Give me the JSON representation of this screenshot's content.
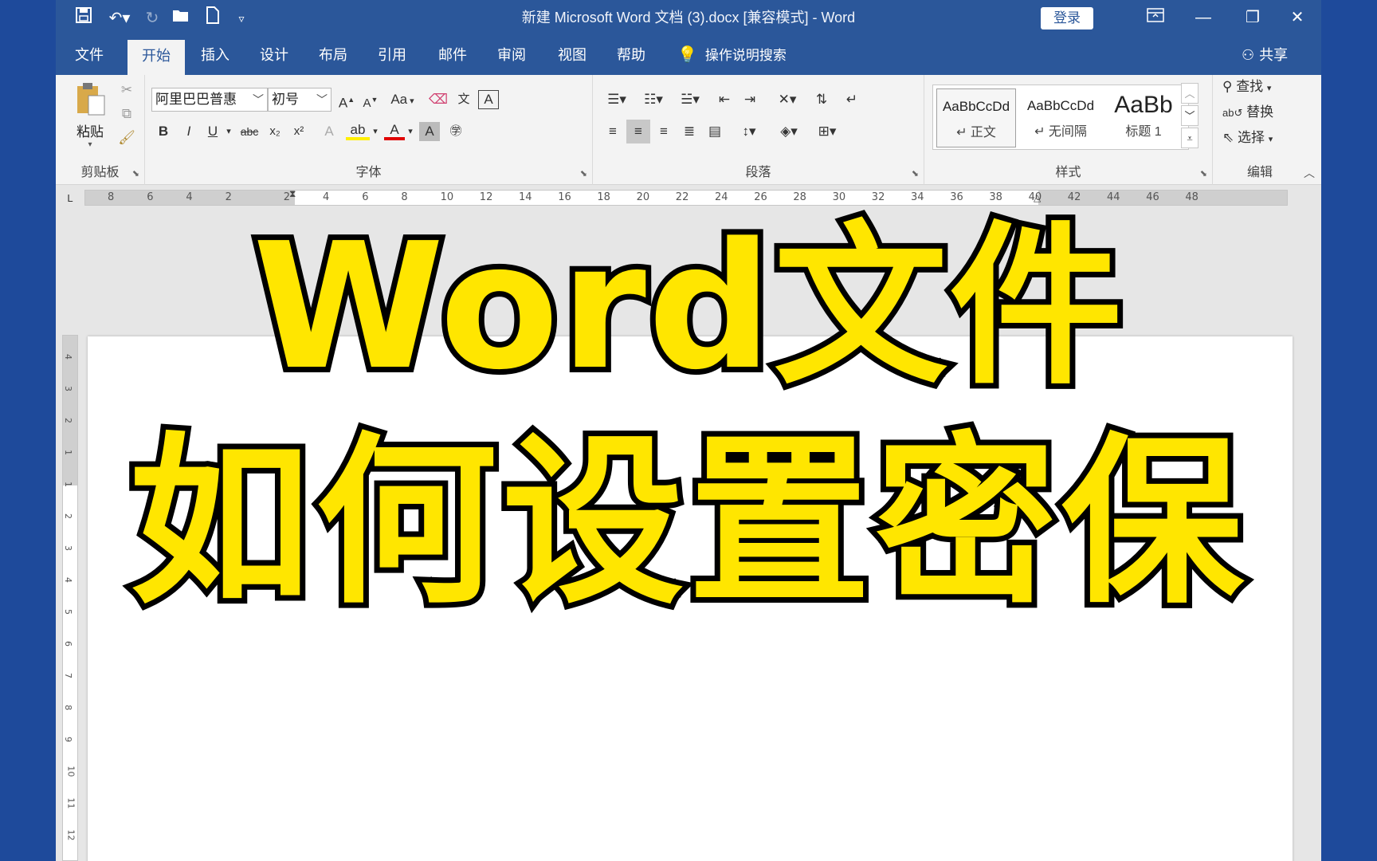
{
  "titlebar": {
    "document_title": "新建 Microsoft Word 文档 (3).docx [兼容模式]  -  Word",
    "login_label": "登录",
    "quick_access": {
      "save_icon": "save-icon",
      "undo_icon": "undo-icon",
      "redo_icon": "redo-icon",
      "open_icon": "open-folder-icon",
      "new_icon": "new-document-icon",
      "customize_icon": "customize-toolbar-icon"
    }
  },
  "tabs": [
    "文件",
    "开始",
    "插入",
    "设计",
    "布局",
    "引用",
    "邮件",
    "审阅",
    "视图",
    "帮助"
  ],
  "active_tab": "开始",
  "tell_me": "操作说明搜索",
  "share_label": "共享",
  "ribbon": {
    "clipboard": {
      "paste_label": "粘贴",
      "group_label": "剪贴板"
    },
    "font": {
      "font_name": "阿里巴巴普惠",
      "font_size": "初号",
      "change_case": "Aa",
      "group_label": "字体"
    },
    "paragraph": {
      "group_label": "段落"
    },
    "styles": {
      "group_label": "样式",
      "items": [
        {
          "sample": "AaBbCcDd",
          "name": "↵ 正文"
        },
        {
          "sample": "AaBbCcDd",
          "name": "↵ 无间隔"
        },
        {
          "sample": "AaBb",
          "name": "标题 1"
        }
      ]
    },
    "editing": {
      "find_label": "查找",
      "replace_label": "替换",
      "select_label": "选择",
      "group_label": "编辑"
    }
  },
  "ruler": {
    "tab_selector": "L",
    "horizontal_numbers": [
      "8",
      "6",
      "4",
      "2",
      "2",
      "4",
      "6",
      "8",
      "10",
      "12",
      "14",
      "16",
      "18",
      "20",
      "22",
      "24",
      "26",
      "28",
      "30",
      "32",
      "34",
      "36",
      "38",
      "40",
      "42",
      "44",
      "46",
      "48"
    ],
    "vertical_numbers": [
      "4",
      "3",
      "2",
      "1",
      "1",
      "2",
      "3",
      "4",
      "5",
      "6",
      "7",
      "8",
      "9",
      "10",
      "11",
      "12"
    ]
  },
  "overlay": {
    "line1": "Word文件",
    "line2": "如何设置密保"
  },
  "colors": {
    "word_blue": "#2b579a",
    "overlay_fill": "#ffe600",
    "overlay_stroke": "#000000",
    "background": "#1e4a9b"
  }
}
